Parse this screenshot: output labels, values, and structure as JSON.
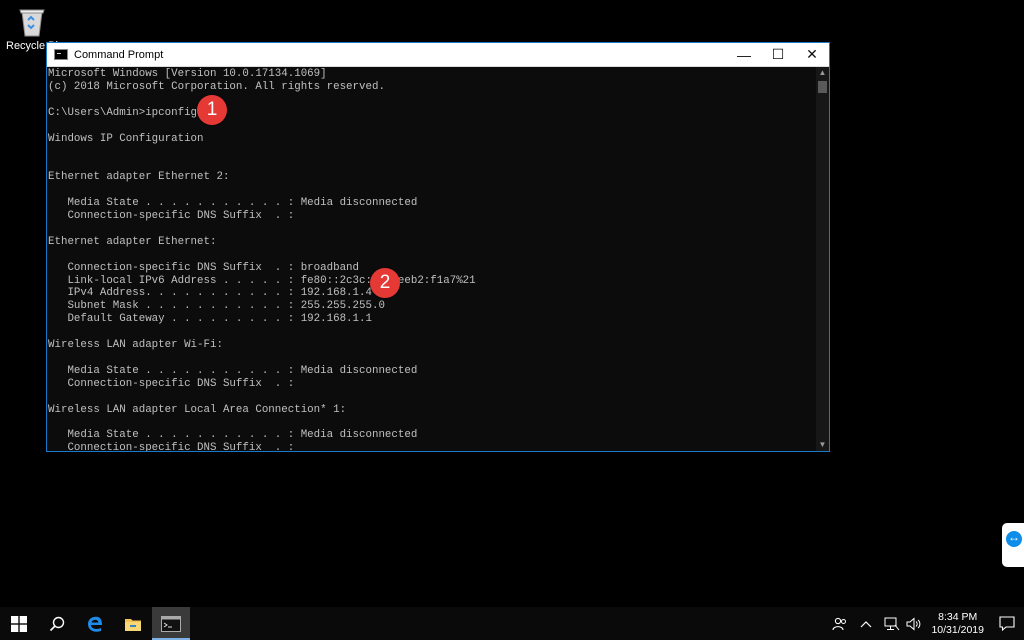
{
  "desktop": {
    "recycle_bin_label": "Recycle Bi"
  },
  "window": {
    "title": "Command Prompt",
    "minimize_glyph": "—",
    "maximize_glyph": "☐",
    "close_glyph": "✕",
    "console_text": "Microsoft Windows [Version 10.0.17134.1069]\n(c) 2018 Microsoft Corporation. All rights reserved.\n\nC:\\Users\\Admin>ipconfig\n\nWindows IP Configuration\n\n\nEthernet adapter Ethernet 2:\n\n   Media State . . . . . . . . . . . : Media disconnected\n   Connection-specific DNS Suffix  . :\n\nEthernet adapter Ethernet:\n\n   Connection-specific DNS Suffix  . : broadband\n   Link-local IPv6 Address . . . . . : fe80::2c3c:    eeb2:f1a7%21\n   IPv4 Address. . . . . . . . . . . : 192.168.1.4\n   Subnet Mask . . . . . . . . . . . : 255.255.255.0\n   Default Gateway . . . . . . . . . : 192.168.1.1\n\nWireless LAN adapter Wi-Fi:\n\n   Media State . . . . . . . . . . . : Media disconnected\n   Connection-specific DNS Suffix  . :\n\nWireless LAN adapter Local Area Connection* 1:\n\n   Media State . . . . . . . . . . . : Media disconnected\n   Connection-specific DNS Suffix  . :"
  },
  "callouts": [
    {
      "label": "1"
    },
    {
      "label": "2"
    }
  ],
  "colors": {
    "callout": "#e53935",
    "console_bg": "#0c0c0c",
    "console_text": "#c0c0c0",
    "window_border": "#1979ca"
  },
  "taskbar": {
    "icons": [
      "windows-start-icon",
      "search-icon",
      "edge-browser-icon",
      "file-explorer-icon",
      "command-prompt-icon"
    ],
    "time": "8:34 PM",
    "date": "10/31/2019"
  }
}
